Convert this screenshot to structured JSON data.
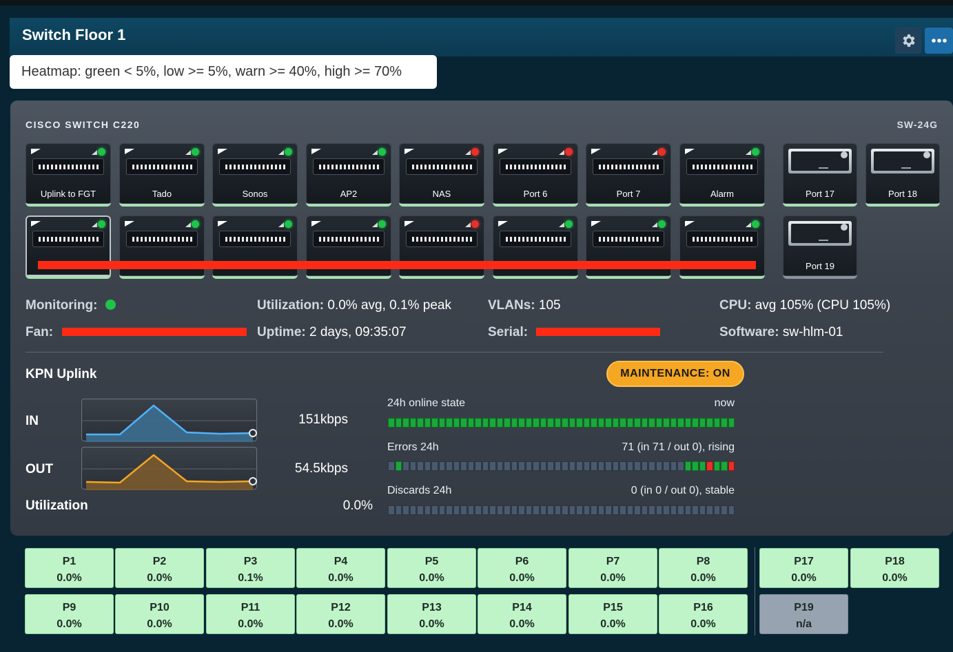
{
  "header": {
    "title": "Switch Floor 1",
    "settings_icon": "gear-icon",
    "more_icon": "more-icon"
  },
  "legend": {
    "text": "Heatmap: green < 5%, low >= 5%, warn >= 40%, high >= 70%"
  },
  "switch": {
    "model": "CISCO SWITCH C220",
    "name": "SW-24G",
    "colors": {
      "link_up": "#1fc34a",
      "link_down": "#e8302a",
      "heat_green": "#bff4c9",
      "na": "#98a3b2"
    },
    "row1": [
      {
        "label": "Uplink to FGT",
        "led": "green"
      },
      {
        "label": "Tado",
        "led": "green"
      },
      {
        "label": "Sonos",
        "led": "green"
      },
      {
        "label": "AP2",
        "led": "green"
      },
      {
        "label": "NAS",
        "led": "red"
      },
      {
        "label": "Port 6",
        "led": "red"
      },
      {
        "label": "Port 7",
        "led": "red"
      },
      {
        "label": "Alarm",
        "led": "green"
      }
    ],
    "row2": [
      {
        "label": "",
        "led": "green"
      },
      {
        "label": "",
        "led": "green"
      },
      {
        "label": "",
        "led": "green"
      },
      {
        "label": "",
        "led": "green"
      },
      {
        "label": "",
        "led": "red"
      },
      {
        "label": "",
        "led": "green"
      },
      {
        "label": "",
        "led": "green"
      },
      {
        "label": "",
        "led": "green"
      }
    ],
    "sfp": [
      {
        "label": "Port 17"
      },
      {
        "label": "Port 18"
      },
      {
        "label": "Port 19"
      }
    ]
  },
  "info": {
    "monitoring_label": "Monitoring:",
    "utilization_label": "Utilization:",
    "utilization_value": "0.0% avg, 0.1% peak",
    "vlans_label": "VLANs:",
    "vlans_value": "105",
    "cpu_label": "CPU:",
    "cpu_value": "avg 105% (CPU 105%)",
    "fan_label": "Fan:",
    "uptime_label": "Uptime:",
    "uptime_value": "2 days, 09:35:07",
    "serial_label": "Serial:",
    "software_label": "Software:",
    "software_value": "sw-hlm-01"
  },
  "uplink": {
    "title": "KPN Uplink",
    "maintenance": "MAINTENANCE: ON",
    "in_label": "IN",
    "in_rate": "151kbps",
    "in_color": "#4fb3ff",
    "out_label": "OUT",
    "out_rate": "54.5kbps",
    "out_color": "#f5a623",
    "util_label": "Utilization",
    "util_value": "0.0%",
    "online_title": "24h online state",
    "online_right": "now",
    "errors_title": "Errors 24h",
    "errors_right": "71 (in 71 / out 0), rising",
    "discards_title": "Discards 24h",
    "discards_right": "0 (in 0 / out 0), stable"
  },
  "heatmap": [
    {
      "port": "P1",
      "value": "0.0%"
    },
    {
      "port": "P2",
      "value": "0.0%"
    },
    {
      "port": "P3",
      "value": "0.1%"
    },
    {
      "port": "P4",
      "value": "0.0%"
    },
    {
      "port": "P5",
      "value": "0.0%"
    },
    {
      "port": "P6",
      "value": "0.0%"
    },
    {
      "port": "P7",
      "value": "0.0%"
    },
    {
      "port": "P8",
      "value": "0.0%"
    },
    {
      "port": "P17",
      "value": "0.0%"
    },
    {
      "port": "P18",
      "value": "0.0%"
    },
    {
      "port": "P9",
      "value": "0.0%"
    },
    {
      "port": "P10",
      "value": "0.0%"
    },
    {
      "port": "P11",
      "value": "0.0%"
    },
    {
      "port": "P12",
      "value": "0.0%"
    },
    {
      "port": "P13",
      "value": "0.0%"
    },
    {
      "port": "P14",
      "value": "0.0%"
    },
    {
      "port": "P15",
      "value": "0.0%"
    },
    {
      "port": "P16",
      "value": "0.0%"
    },
    {
      "port": "P19",
      "value": "n/a"
    }
  ]
}
